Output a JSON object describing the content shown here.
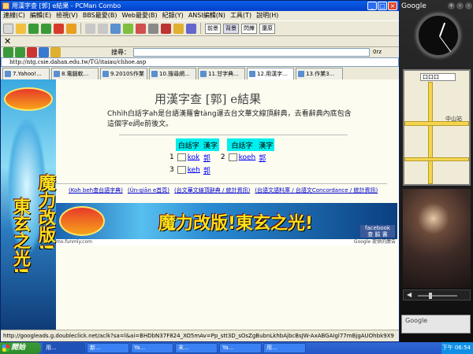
{
  "window": {
    "title": "用漢字查 [郭] e結果 - PCMan Combo"
  },
  "menu": [
    "連線(C)",
    "編輯(E)",
    "檢視(V)",
    "BBS最愛(B)",
    "Web最愛(B)",
    "紀錄(Y)",
    "ANSI編輯(N)",
    "工具(T)",
    "說明(H)"
  ],
  "toolbar": {
    "toggle1": "前景",
    "toggle2": "背景",
    "toggle3": "閃爍",
    "toggle4": "還原"
  },
  "search": {
    "label": "搜尋：",
    "option": "0rz"
  },
  "address": "http://ntg.csie.dahan.edu.tw/TG/itaiau/chhoe.asp",
  "tabs": [
    "7.Yahoo!...",
    "8.電腦軟...",
    "9.2010S作業",
    "10.搜尋網...",
    "11.甘字典...",
    "12.用漢字...",
    "13.作業3..."
  ],
  "page": {
    "title": "用漢字查 [郭] e結果",
    "intro": "Chhìh白話字ah是台語漢羅會tàng運去台文華文線頂辭典，去看辭典內底包含這個字e詞e前後文。",
    "headers": [
      "白話字",
      "漢字",
      "白話字",
      "漢字"
    ],
    "results": [
      {
        "n": "1",
        "word": "kok",
        "han": "郭"
      },
      {
        "n": "2",
        "word": "koeh",
        "han": "郭"
      },
      {
        "n": "3",
        "word": "keh",
        "han": "郭"
      }
    ],
    "links": [
      "(Koh beh查台語字典)",
      "(Ún-giān e首頁)",
      "(台文華文線頂辭典 / 統計資訊)",
      "(台語文語料庫 / 台語文Concordance / 統計資訊)"
    ]
  },
  "ads": {
    "left_line1": "魔力改版!",
    "left_line2": "東玄之光!",
    "banner_text": "魔力改版!東玄之光!",
    "fb_label": "facebook",
    "fb_sub": "查 臉 書",
    "url_left": "mo.funmly.com",
    "url_right": "Google 提供的廣告"
  },
  "status": "http://googleads.g.doubleclick.net/aclk?sa=l&ai=BHDbN37F824_XO5mAv=Pp_stt3D_sOsZgBubnLkhbAjbcBsJW-AxABGAIgl77mBjgAUOhbk9X9",
  "taskbar": {
    "start": "開始",
    "items": [
      "用...",
      "新...",
      "Ya...",
      "末...",
      "Ya...",
      "用..."
    ],
    "clock": "下午 06:54"
  },
  "sidebar": {
    "header": "Google",
    "map_select": "口口口",
    "map_label": "中山站",
    "search_label": "Google"
  }
}
